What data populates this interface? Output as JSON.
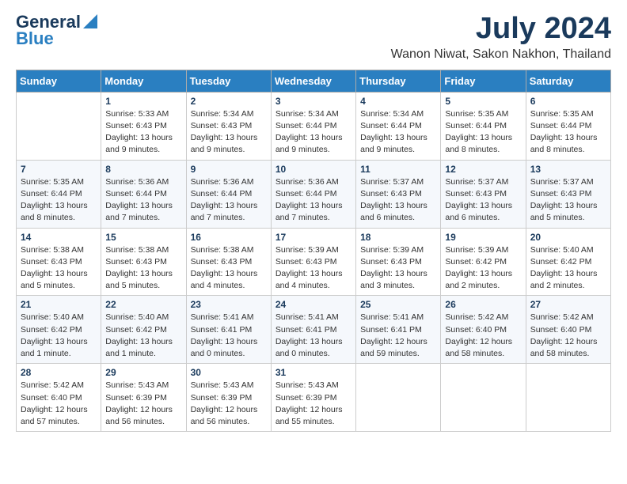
{
  "header": {
    "logo_line1": "General",
    "logo_line2": "Blue",
    "month_year": "July 2024",
    "location": "Wanon Niwat, Sakon Nakhon, Thailand"
  },
  "days_of_week": [
    "Sunday",
    "Monday",
    "Tuesday",
    "Wednesday",
    "Thursday",
    "Friday",
    "Saturday"
  ],
  "weeks": [
    [
      {
        "day": "",
        "content": ""
      },
      {
        "day": "1",
        "content": "Sunrise: 5:33 AM\nSunset: 6:43 PM\nDaylight: 13 hours\nand 9 minutes."
      },
      {
        "day": "2",
        "content": "Sunrise: 5:34 AM\nSunset: 6:43 PM\nDaylight: 13 hours\nand 9 minutes."
      },
      {
        "day": "3",
        "content": "Sunrise: 5:34 AM\nSunset: 6:44 PM\nDaylight: 13 hours\nand 9 minutes."
      },
      {
        "day": "4",
        "content": "Sunrise: 5:34 AM\nSunset: 6:44 PM\nDaylight: 13 hours\nand 9 minutes."
      },
      {
        "day": "5",
        "content": "Sunrise: 5:35 AM\nSunset: 6:44 PM\nDaylight: 13 hours\nand 8 minutes."
      },
      {
        "day": "6",
        "content": "Sunrise: 5:35 AM\nSunset: 6:44 PM\nDaylight: 13 hours\nand 8 minutes."
      }
    ],
    [
      {
        "day": "7",
        "content": "Sunrise: 5:35 AM\nSunset: 6:44 PM\nDaylight: 13 hours\nand 8 minutes."
      },
      {
        "day": "8",
        "content": "Sunrise: 5:36 AM\nSunset: 6:44 PM\nDaylight: 13 hours\nand 7 minutes."
      },
      {
        "day": "9",
        "content": "Sunrise: 5:36 AM\nSunset: 6:44 PM\nDaylight: 13 hours\nand 7 minutes."
      },
      {
        "day": "10",
        "content": "Sunrise: 5:36 AM\nSunset: 6:44 PM\nDaylight: 13 hours\nand 7 minutes."
      },
      {
        "day": "11",
        "content": "Sunrise: 5:37 AM\nSunset: 6:43 PM\nDaylight: 13 hours\nand 6 minutes."
      },
      {
        "day": "12",
        "content": "Sunrise: 5:37 AM\nSunset: 6:43 PM\nDaylight: 13 hours\nand 6 minutes."
      },
      {
        "day": "13",
        "content": "Sunrise: 5:37 AM\nSunset: 6:43 PM\nDaylight: 13 hours\nand 5 minutes."
      }
    ],
    [
      {
        "day": "14",
        "content": "Sunrise: 5:38 AM\nSunset: 6:43 PM\nDaylight: 13 hours\nand 5 minutes."
      },
      {
        "day": "15",
        "content": "Sunrise: 5:38 AM\nSunset: 6:43 PM\nDaylight: 13 hours\nand 5 minutes."
      },
      {
        "day": "16",
        "content": "Sunrise: 5:38 AM\nSunset: 6:43 PM\nDaylight: 13 hours\nand 4 minutes."
      },
      {
        "day": "17",
        "content": "Sunrise: 5:39 AM\nSunset: 6:43 PM\nDaylight: 13 hours\nand 4 minutes."
      },
      {
        "day": "18",
        "content": "Sunrise: 5:39 AM\nSunset: 6:43 PM\nDaylight: 13 hours\nand 3 minutes."
      },
      {
        "day": "19",
        "content": "Sunrise: 5:39 AM\nSunset: 6:42 PM\nDaylight: 13 hours\nand 2 minutes."
      },
      {
        "day": "20",
        "content": "Sunrise: 5:40 AM\nSunset: 6:42 PM\nDaylight: 13 hours\nand 2 minutes."
      }
    ],
    [
      {
        "day": "21",
        "content": "Sunrise: 5:40 AM\nSunset: 6:42 PM\nDaylight: 13 hours\nand 1 minute."
      },
      {
        "day": "22",
        "content": "Sunrise: 5:40 AM\nSunset: 6:42 PM\nDaylight: 13 hours\nand 1 minute."
      },
      {
        "day": "23",
        "content": "Sunrise: 5:41 AM\nSunset: 6:41 PM\nDaylight: 13 hours\nand 0 minutes."
      },
      {
        "day": "24",
        "content": "Sunrise: 5:41 AM\nSunset: 6:41 PM\nDaylight: 13 hours\nand 0 minutes."
      },
      {
        "day": "25",
        "content": "Sunrise: 5:41 AM\nSunset: 6:41 PM\nDaylight: 12 hours\nand 59 minutes."
      },
      {
        "day": "26",
        "content": "Sunrise: 5:42 AM\nSunset: 6:40 PM\nDaylight: 12 hours\nand 58 minutes."
      },
      {
        "day": "27",
        "content": "Sunrise: 5:42 AM\nSunset: 6:40 PM\nDaylight: 12 hours\nand 58 minutes."
      }
    ],
    [
      {
        "day": "28",
        "content": "Sunrise: 5:42 AM\nSunset: 6:40 PM\nDaylight: 12 hours\nand 57 minutes."
      },
      {
        "day": "29",
        "content": "Sunrise: 5:43 AM\nSunset: 6:39 PM\nDaylight: 12 hours\nand 56 minutes."
      },
      {
        "day": "30",
        "content": "Sunrise: 5:43 AM\nSunset: 6:39 PM\nDaylight: 12 hours\nand 56 minutes."
      },
      {
        "day": "31",
        "content": "Sunrise: 5:43 AM\nSunset: 6:39 PM\nDaylight: 12 hours\nand 55 minutes."
      },
      {
        "day": "",
        "content": ""
      },
      {
        "day": "",
        "content": ""
      },
      {
        "day": "",
        "content": ""
      }
    ]
  ]
}
